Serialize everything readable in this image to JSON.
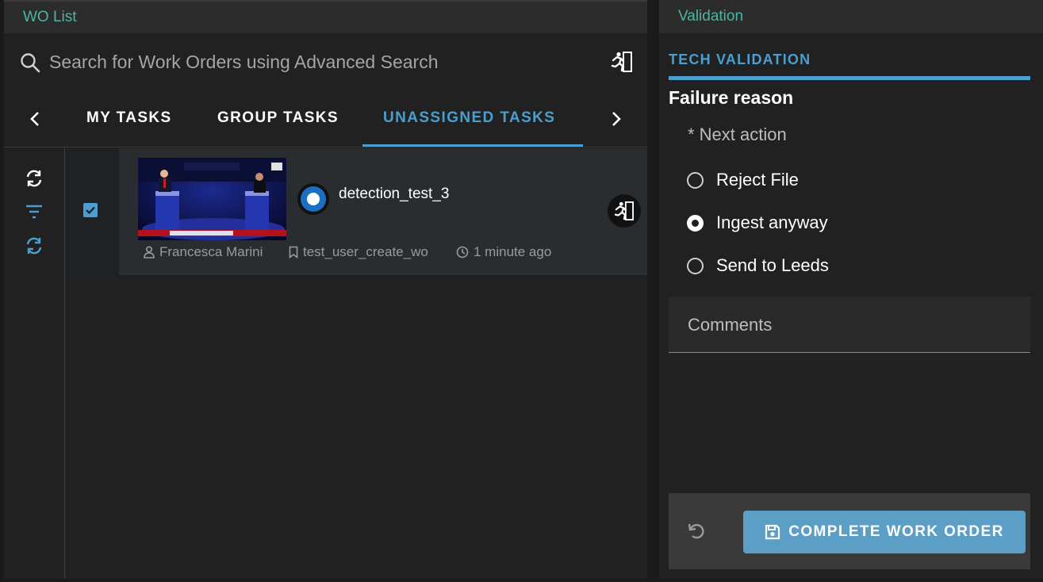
{
  "wo_panel": {
    "header_title": "WO List",
    "search_placeholder": "Search for Work Orders using Advanced Search",
    "tabs": [
      {
        "label": "MY TASKS"
      },
      {
        "label": "GROUP TASKS"
      },
      {
        "label": "UNASSIGNED TASKS"
      }
    ],
    "active_tab": "UNASSIGNED TASKS",
    "work_orders": [
      {
        "title": "detection_test_3",
        "user": "Francesca Marini",
        "tag": "test_user_create_wo",
        "time": "1 minute ago",
        "checked": true
      }
    ]
  },
  "validation_panel": {
    "header_title": "Validation",
    "tab_label": "TECH VALIDATION",
    "failure_reason": "Failure reason",
    "next_action_label": "* Next action",
    "options": [
      {
        "label": "Reject File",
        "selected": false
      },
      {
        "label": "Ingest anyway",
        "selected": true
      },
      {
        "label": "Send to Leeds",
        "selected": false
      }
    ],
    "comments_placeholder": "Comments",
    "complete_button": "COMPLETE WORK ORDER"
  },
  "colors": {
    "accent": "#4a9fd0",
    "header_text": "#4fb3a3",
    "button": "#5b9ec6"
  }
}
